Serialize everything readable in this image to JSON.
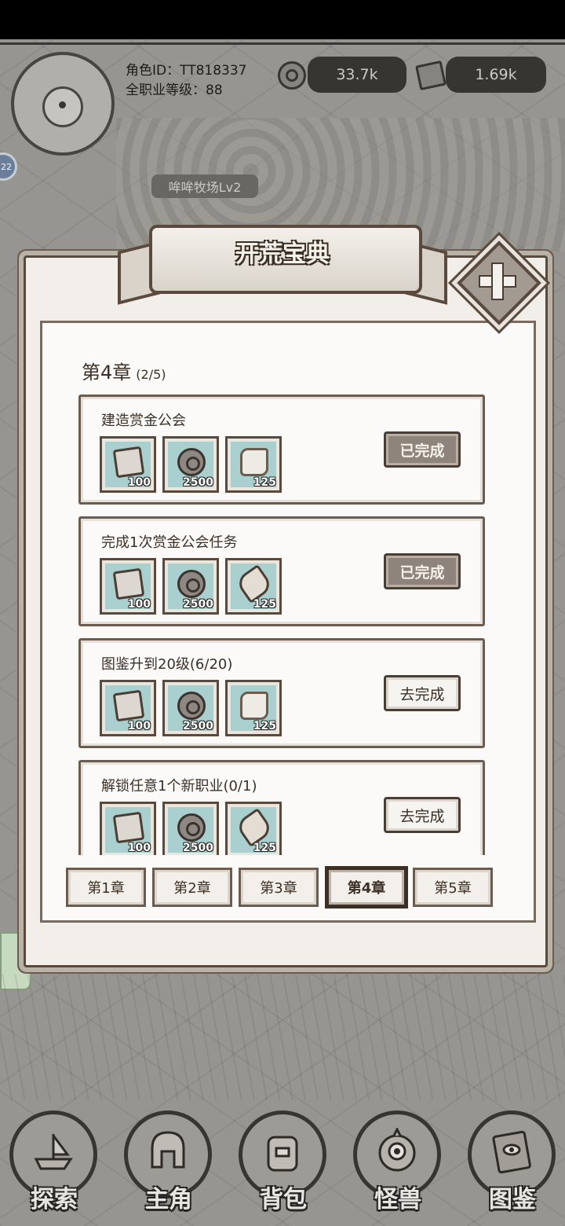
{
  "hud": {
    "role_id": "角色ID：TT818337",
    "job_level": "全职业等级：88",
    "coins": "33.7k",
    "stones": "1.69k",
    "farm_tag": "哞哞牧场Lv2",
    "side_badge": "22"
  },
  "modal": {
    "title": "开荒宝典",
    "chapter_title": "第4章",
    "chapter_progress": "(2/5)",
    "tasks": [
      {
        "name": "建造赏金公会",
        "rewards": [
          {
            "icon": "stone-icon",
            "qty": "100"
          },
          {
            "icon": "coin-icon",
            "qty": "2500"
          },
          {
            "icon": "ore-icon",
            "qty": "125"
          }
        ],
        "button": "已完成",
        "status": "done"
      },
      {
        "name": "完成1次赏金公会任务",
        "rewards": [
          {
            "icon": "stone-icon",
            "qty": "100"
          },
          {
            "icon": "coin-icon",
            "qty": "2500"
          },
          {
            "icon": "log-icon",
            "qty": "125"
          }
        ],
        "button": "已完成",
        "status": "done"
      },
      {
        "name": "图鉴升到20级(6/20)",
        "rewards": [
          {
            "icon": "stone-icon",
            "qty": "100"
          },
          {
            "icon": "coin-icon",
            "qty": "2500"
          },
          {
            "icon": "ore-icon",
            "qty": "125"
          }
        ],
        "button": "去完成",
        "status": "go"
      },
      {
        "name": "解锁任意1个新职业(0/1)",
        "rewards": [
          {
            "icon": "stone-icon",
            "qty": "100"
          },
          {
            "icon": "coin-icon",
            "qty": "2500"
          },
          {
            "icon": "log-icon",
            "qty": "125"
          }
        ],
        "button": "去完成",
        "status": "go"
      }
    ],
    "chapter_tabs": [
      "第1章",
      "第2章",
      "第3章",
      "第4章",
      "第5章"
    ],
    "active_tab": 3
  },
  "bottom_nav": [
    {
      "label": "探索",
      "icon": "ship-icon"
    },
    {
      "label": "主角",
      "icon": "helmet-icon"
    },
    {
      "label": "背包",
      "icon": "backpack-icon"
    },
    {
      "label": "怪兽",
      "icon": "monster-icon"
    },
    {
      "label": "图鉴",
      "icon": "book-icon"
    }
  ]
}
